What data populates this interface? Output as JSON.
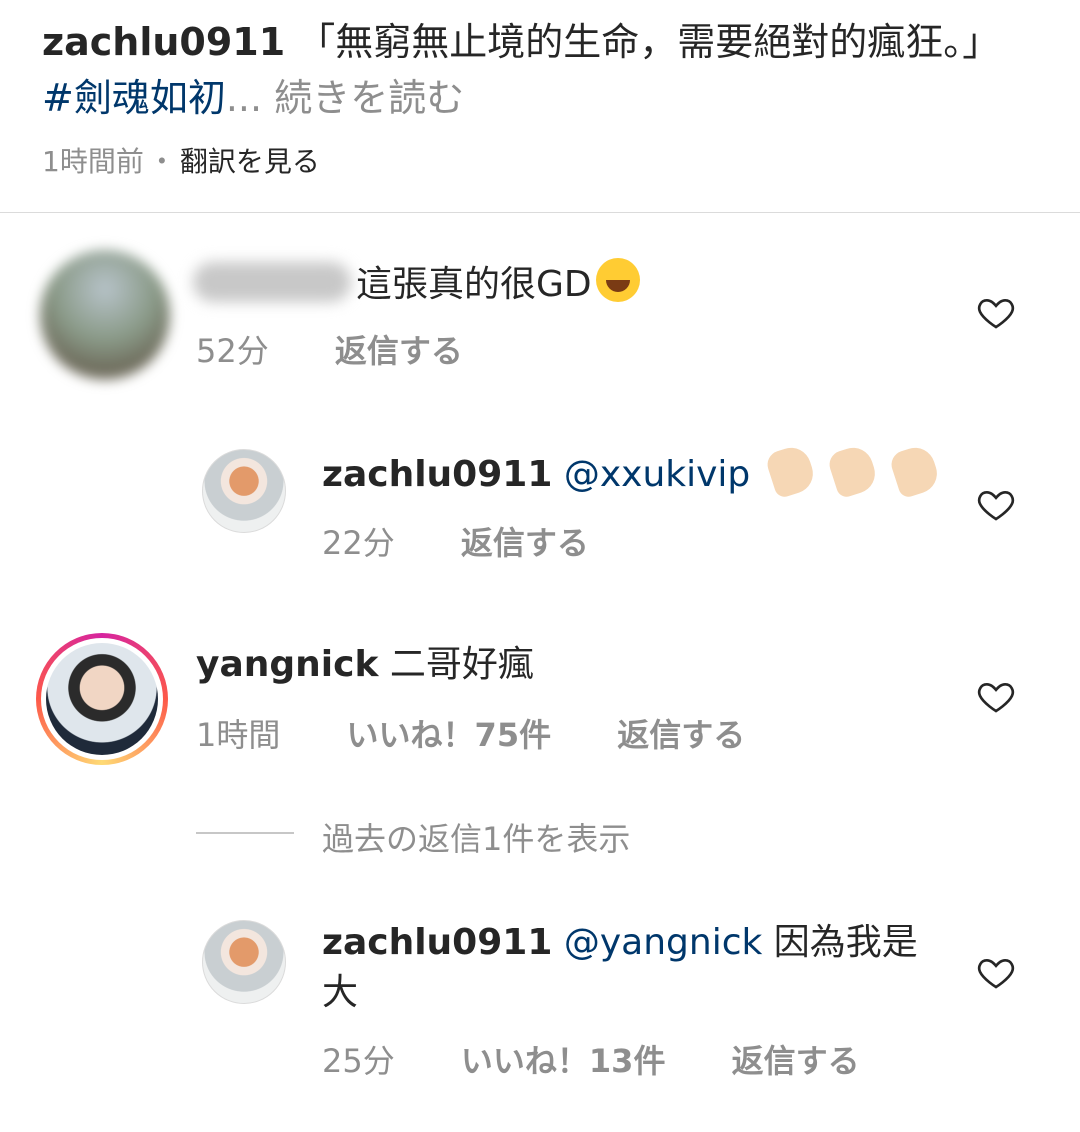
{
  "caption": {
    "username": "zachlu0911",
    "text": "「無窮無止境的生命，需要絕對的瘋狂。」",
    "hashtag": "#劍魂如初",
    "ellipsis": "...",
    "more_label": "続きを読む",
    "time": "1時間前",
    "separator": "・",
    "translate_label": "翻訳を見る"
  },
  "comments": [
    {
      "username": "",
      "text": "這張真的很GD",
      "emoji": "face-with-tears-of-joy",
      "time": "52分",
      "reply_label": "返信する",
      "liked": false
    },
    {
      "username": "zachlu0911",
      "mention": "@xxukivip",
      "text": "",
      "emoji": "call-me-hand x3",
      "time": "22分",
      "reply_label": "返信する",
      "liked": false
    },
    {
      "username": "yangnick",
      "text": "二哥好瘋",
      "time": "1時間",
      "likes_label": "いいね！75件",
      "reply_label": "返信する",
      "liked": false
    },
    {
      "username": "zachlu0911",
      "mention": "@yangnick",
      "text": "因為我是大",
      "time": "25分",
      "likes_label": "いいね！13件",
      "reply_label": "返信する",
      "liked": false
    }
  ],
  "view_replies_label": "過去の返信1件を表示",
  "colors": {
    "text": "#262626",
    "secondary": "#8e8e8e",
    "link": "#00376b",
    "divider": "#dbdbdb"
  }
}
